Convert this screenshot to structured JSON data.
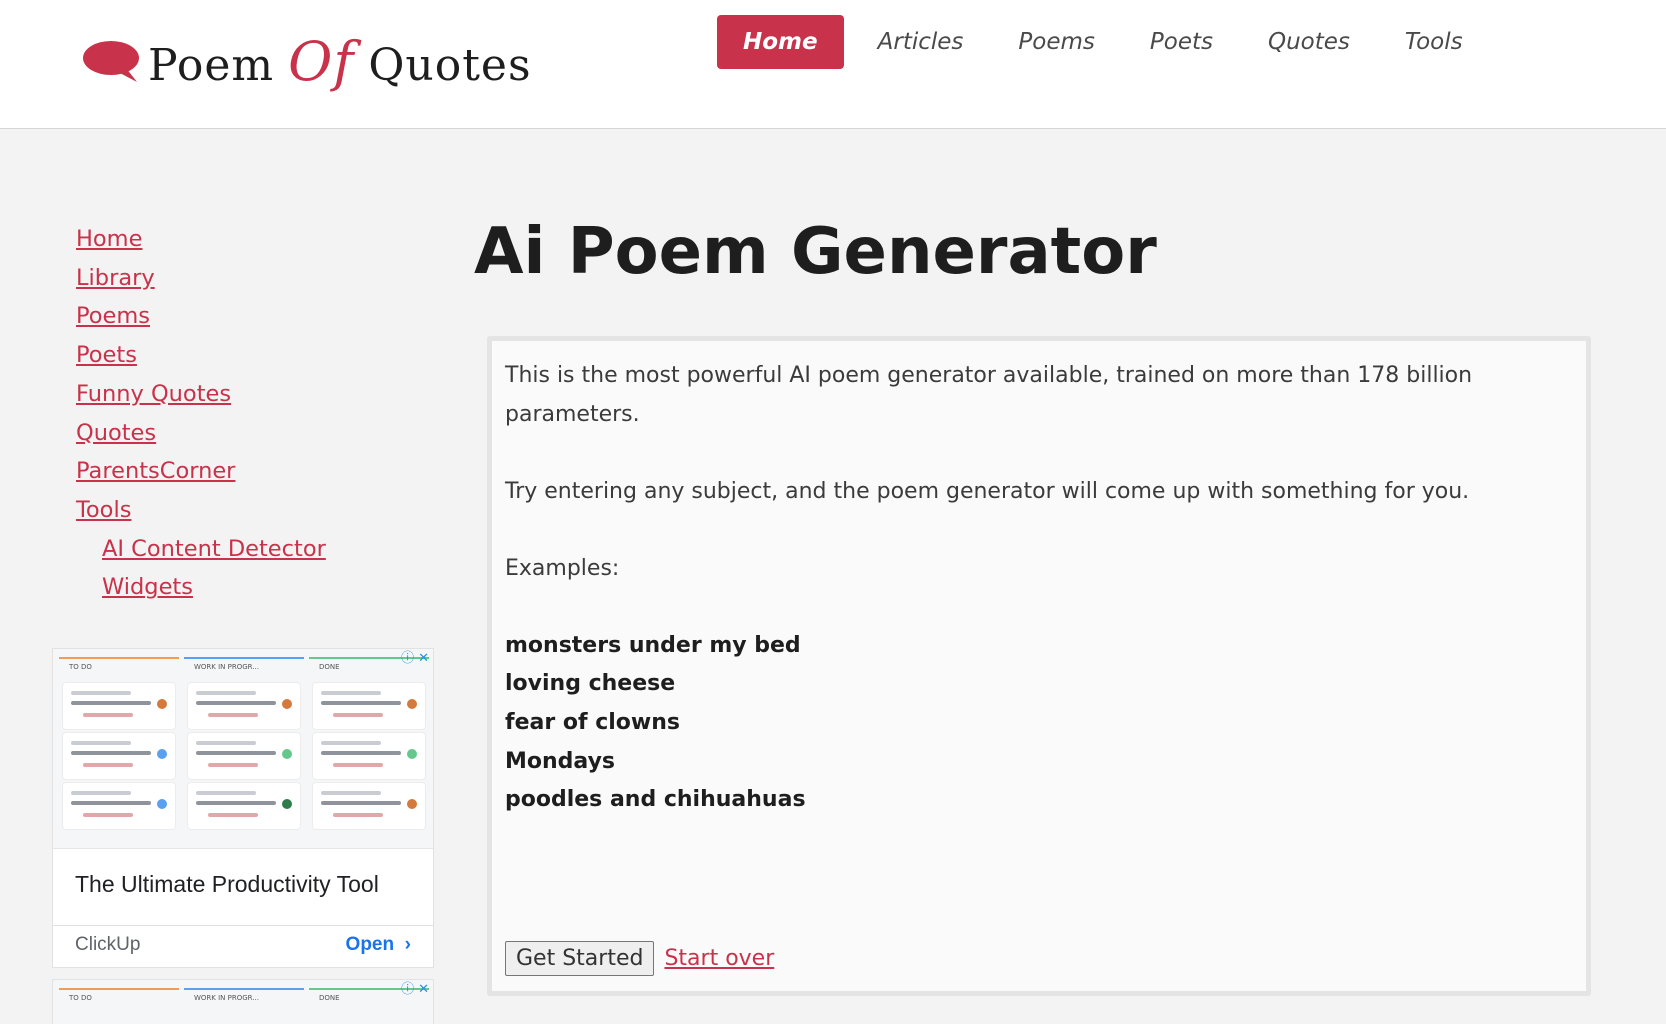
{
  "header": {
    "logo": {
      "word1": "Poem",
      "word2": "Of",
      "word3": "Quotes"
    },
    "nav": [
      {
        "label": "Home",
        "active": true
      },
      {
        "label": "Articles",
        "active": false
      },
      {
        "label": "Poems",
        "active": false
      },
      {
        "label": "Poets",
        "active": false
      },
      {
        "label": "Quotes",
        "active": false
      },
      {
        "label": "Tools",
        "active": false
      }
    ]
  },
  "sidebar": {
    "links": [
      "Home",
      "Library",
      "Poems",
      "Poets",
      "Funny Quotes",
      "Quotes",
      "ParentsCorner",
      "Tools"
    ],
    "sublinks": [
      "AI Content Detector",
      "Widgets"
    ]
  },
  "ad": {
    "title": "The Ultimate Productivity Tool",
    "brand": "ClickUp",
    "cta": "Open",
    "columns": [
      "TO DO",
      "WORK IN PROGR...",
      "DONE"
    ]
  },
  "main": {
    "title": "Ai Poem Generator",
    "intro": "This is the most powerful AI poem generator available, trained on more than 178 billion parameters.",
    "instruction": "Try entering any subject, and the poem generator will come up with something for you.",
    "examples_label": "Examples:",
    "examples": [
      "monsters under my bed",
      "loving cheese",
      "fear of clowns",
      "Mondays",
      "poodles and chihuahuas"
    ],
    "get_started": "Get Started",
    "start_over": "Start over"
  },
  "colors": {
    "brand_red": "#c8324a",
    "background": "#f3f3f3",
    "ad_link_blue": "#1a73e8"
  },
  "icons": [
    "speech-bubble-logo-icon",
    "ad-info-icon",
    "ad-close-icon",
    "chevron-right-icon"
  ]
}
